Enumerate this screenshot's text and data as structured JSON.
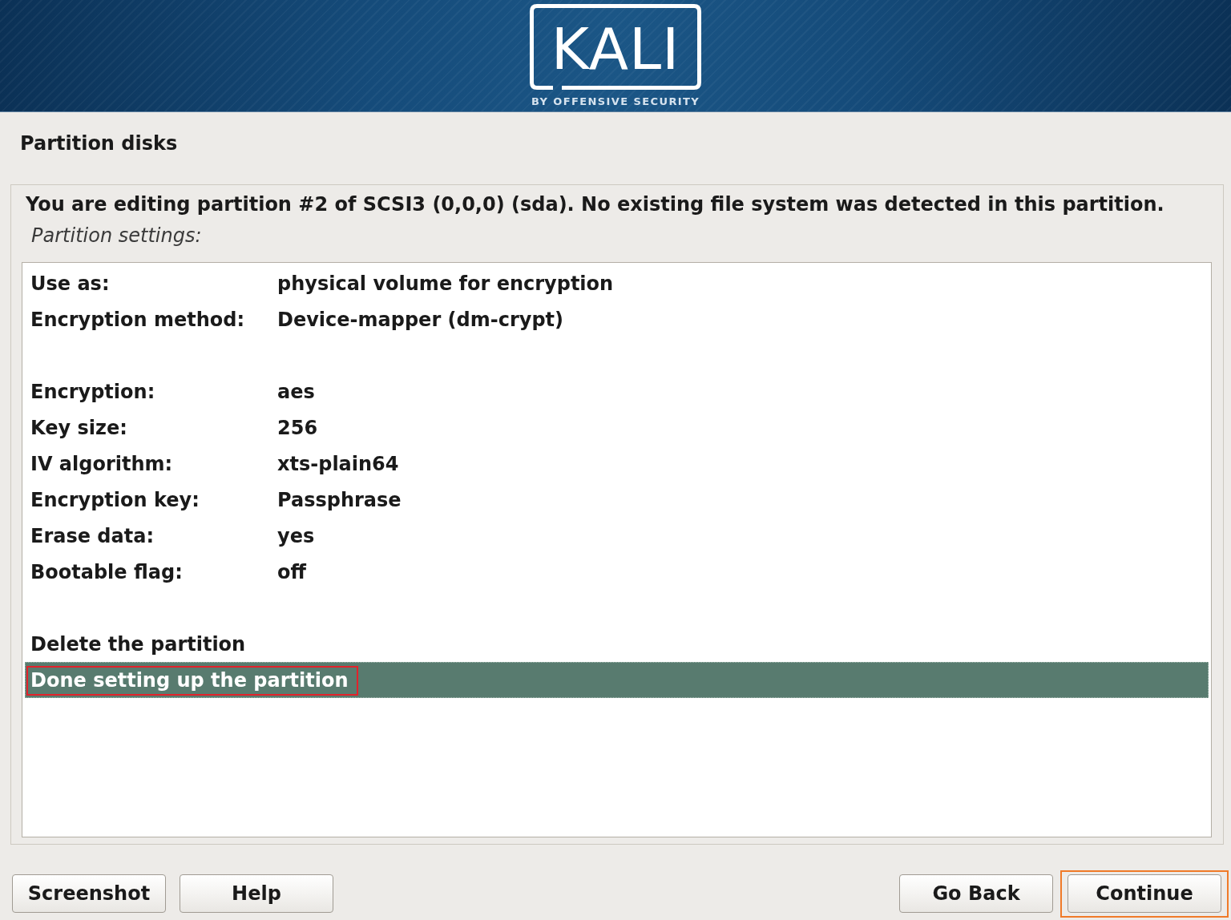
{
  "header": {
    "logo": {
      "wordmark": "KALI",
      "tagline": "BY OFFENSIVE SECURITY"
    }
  },
  "page_title": "Partition disks",
  "message": "You are editing partition #2 of SCSI3 (0,0,0) (sda). No existing file system was detected in this partition.",
  "list_caption": "Partition settings:",
  "menu": {
    "sections": [
      {
        "items": [
          {
            "kind": "setting",
            "label": "Use as:",
            "value": "physical volume for encryption",
            "selected": false,
            "highlighted": false
          },
          {
            "kind": "setting",
            "label": "Encryption method:",
            "value": "Device-mapper (dm-crypt)",
            "selected": false,
            "highlighted": false
          }
        ]
      },
      {
        "items": [
          {
            "kind": "setting",
            "label": "Encryption:",
            "value": "aes",
            "selected": false,
            "highlighted": false
          },
          {
            "kind": "setting",
            "label": "Key size:",
            "value": "256",
            "selected": false,
            "highlighted": false
          },
          {
            "kind": "setting",
            "label": "IV algorithm:",
            "value": "xts-plain64",
            "selected": false,
            "highlighted": false
          },
          {
            "kind": "setting",
            "label": "Encryption key:",
            "value": "Passphrase",
            "selected": false,
            "highlighted": false
          },
          {
            "kind": "setting",
            "label": "Erase data:",
            "value": "yes",
            "selected": false,
            "highlighted": false
          },
          {
            "kind": "setting",
            "label": "Bootable flag:",
            "value": "off",
            "selected": false,
            "highlighted": false
          }
        ]
      },
      {
        "items": [
          {
            "kind": "action",
            "label": "Delete the partition",
            "selected": false,
            "highlighted": false
          },
          {
            "kind": "action",
            "label": "Done setting up the partition",
            "selected": true,
            "highlighted": true
          }
        ]
      }
    ]
  },
  "buttons": {
    "left": [
      {
        "label": "Screenshot",
        "highlighted": false
      },
      {
        "label": "Help",
        "highlighted": false
      }
    ],
    "right": [
      {
        "label": "Go Back",
        "highlighted": false
      },
      {
        "label": "Continue",
        "highlighted": true
      }
    ]
  }
}
